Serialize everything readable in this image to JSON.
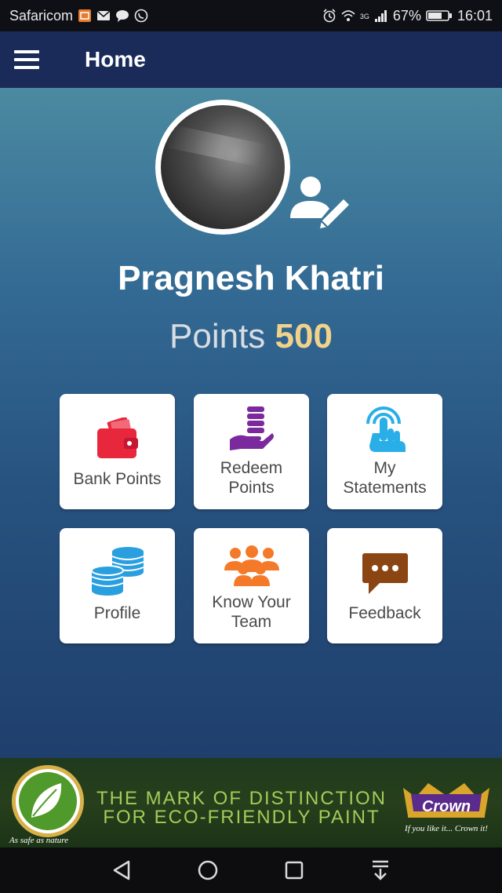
{
  "status_bar": {
    "carrier": "Safaricom",
    "signal_tag": "3G",
    "battery_percent": "67%",
    "time": "16:01"
  },
  "app_bar": {
    "title": "Home"
  },
  "profile": {
    "name": "Pragnesh Khatri",
    "points_label": "Points",
    "points_value": "500"
  },
  "tiles": [
    {
      "label": "Bank Points",
      "icon": "wallet-icon",
      "color": "#e8273d"
    },
    {
      "label": "Redeem Points",
      "icon": "redeem-coins-hand-icon",
      "color": "#7a2a9c"
    },
    {
      "label": "My Statements",
      "icon": "touch-hand-icon",
      "color": "#29aee8"
    },
    {
      "label": "Profile",
      "icon": "coin-stacks-icon",
      "color": "#2a9fe0"
    },
    {
      "label": "Know Your Team",
      "icon": "team-icon",
      "color": "#f47a2a"
    },
    {
      "label": "Feedback",
      "icon": "speech-bubble-icon",
      "color": "#8b4512"
    }
  ],
  "banner": {
    "line1": "THE MARK OF DISTINCTION",
    "line2": "FOR ECO-FRIENDLY PAINT",
    "eco_slogan": "As safe as nature",
    "brand": "Crown",
    "brand_tagline": "If you like it... Crown it!",
    "text_color": "#a3cc58"
  },
  "colors": {
    "app_bar": "#1a2b5a",
    "points_value": "#f1d28a"
  }
}
